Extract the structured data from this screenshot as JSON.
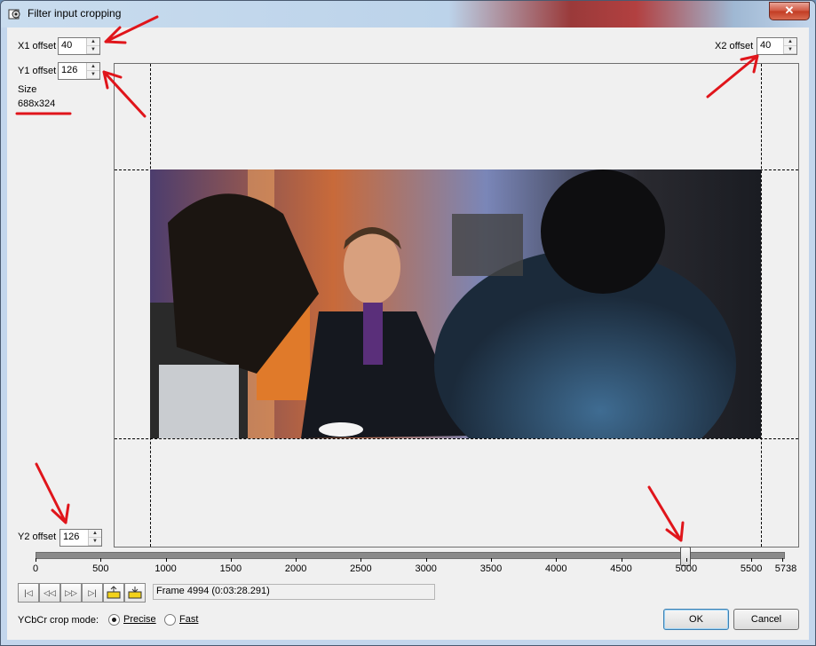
{
  "window": {
    "title": "Filter input cropping",
    "close_symbol": "✕"
  },
  "crop": {
    "x1_label": "X1 offset",
    "x1_value": "40",
    "y1_label": "Y1 offset",
    "y1_value": "126",
    "x2_label": "X2 offset",
    "x2_value": "40",
    "y2_label": "Y2 offset",
    "y2_value": "126",
    "size_label": "Size",
    "size_value": "688x324"
  },
  "timeline": {
    "ticks": [
      "0",
      "500",
      "1000",
      "1500",
      "2000",
      "2500",
      "3000",
      "3500",
      "4000",
      "4500",
      "5000",
      "5500",
      "5738"
    ],
    "max_frame": 5738,
    "current_frame": 4994,
    "frame_text": "Frame 4994 (0:03:28.291)"
  },
  "nav_buttons": [
    "|◁",
    "◁◁",
    "▷▷",
    "▷|"
  ],
  "ycbcr": {
    "label": "YCbCr crop mode:",
    "options": [
      {
        "label": "Precise",
        "selected": true
      },
      {
        "label": "Fast",
        "selected": false
      }
    ]
  },
  "buttons": {
    "ok": "OK",
    "cancel": "Cancel"
  },
  "colors": {
    "annotation_red": "#e0151b",
    "title_accent": "#b24040"
  }
}
